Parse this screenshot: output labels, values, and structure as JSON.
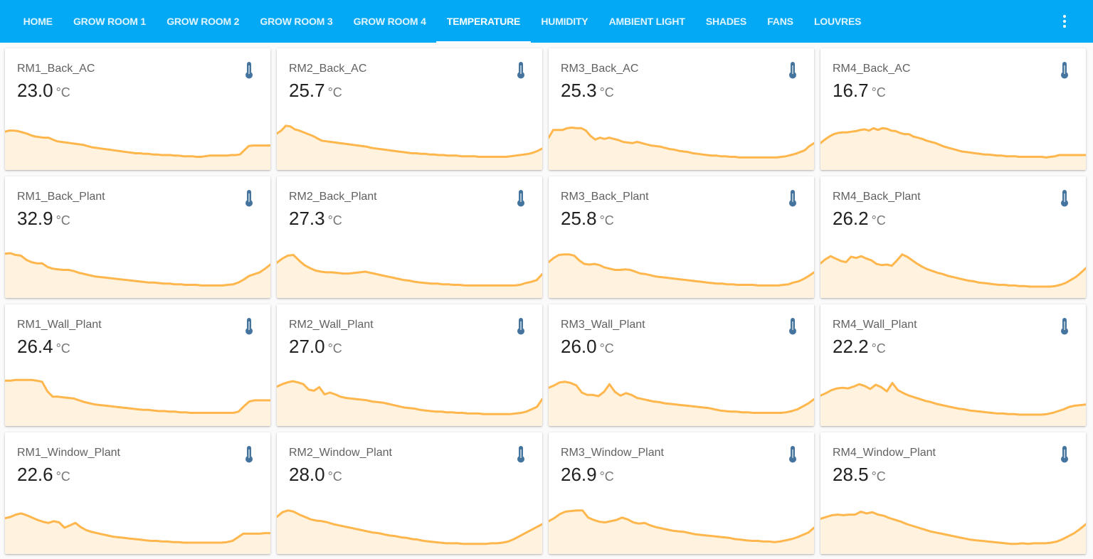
{
  "nav": {
    "tabs": [
      {
        "label": "HOME"
      },
      {
        "label": "GROW ROOM 1"
      },
      {
        "label": "GROW ROOM 2"
      },
      {
        "label": "GROW ROOM 3"
      },
      {
        "label": "GROW ROOM 4"
      },
      {
        "label": "TEMPERATURE"
      },
      {
        "label": "HUMIDITY"
      },
      {
        "label": "AMBIENT LIGHT"
      },
      {
        "label": "SHADES"
      },
      {
        "label": "FANS"
      },
      {
        "label": "LOUVRES"
      }
    ],
    "active_tab": "TEMPERATURE",
    "menu_icon": "dots-vertical-icon"
  },
  "colors": {
    "header": "#03a9f4",
    "line": "#ffb74d",
    "fill": "#fff3e0",
    "icon": "#44739e"
  },
  "unit": "°C",
  "sensor_icon": "thermometer-icon",
  "cards": [
    {
      "name": "RM1_Back_AC",
      "value": "23.0",
      "history": [
        64,
        66,
        66,
        65,
        63,
        61,
        58,
        56,
        55,
        54,
        54,
        51,
        48,
        47,
        46,
        45,
        44,
        43,
        42,
        40,
        38,
        37,
        36,
        35,
        34,
        33,
        32,
        31,
        30,
        29,
        28,
        28,
        27,
        27,
        26,
        26,
        25,
        25,
        25,
        24,
        24,
        23,
        23,
        23,
        22,
        22,
        23,
        24,
        24,
        24,
        24,
        24,
        25,
        25,
        26,
        33,
        40,
        41,
        41,
        41,
        41,
        41
      ]
    },
    {
      "name": "RM2_Back_AC",
      "value": "25.7",
      "history": [
        61,
        66,
        74,
        73,
        68,
        66,
        63,
        60,
        57,
        53,
        49,
        48,
        47,
        46,
        45,
        44,
        43,
        42,
        41,
        40,
        39,
        37,
        36,
        35,
        34,
        33,
        32,
        31,
        30,
        29,
        28,
        28,
        27,
        27,
        26,
        26,
        25,
        25,
        24,
        24,
        24,
        23,
        23,
        23,
        23,
        22,
        22,
        22,
        22,
        22,
        22,
        22,
        23,
        24,
        25,
        26,
        27,
        29,
        32,
        36
      ]
    },
    {
      "name": "RM3_Back_AC",
      "value": "25.3",
      "history": [
        54,
        67,
        67,
        67,
        70,
        71,
        70,
        70,
        66,
        57,
        51,
        54,
        52,
        54,
        52,
        50,
        47,
        46,
        45,
        47,
        45,
        43,
        41,
        40,
        39,
        37,
        35,
        34,
        32,
        31,
        30,
        28,
        27,
        26,
        25,
        24,
        24,
        23,
        23,
        22,
        22,
        21,
        21,
        21,
        21,
        21,
        21,
        21,
        21,
        21,
        22,
        23,
        25,
        27,
        30,
        33,
        40,
        45
      ]
    },
    {
      "name": "RM4_Back_AC",
      "value": "16.7",
      "history": [
        45,
        51,
        56,
        60,
        62,
        63,
        63,
        64,
        65,
        67,
        68,
        66,
        70,
        67,
        70,
        69,
        66,
        65,
        62,
        60,
        60,
        56,
        54,
        52,
        49,
        47,
        45,
        42,
        39,
        37,
        35,
        33,
        31,
        30,
        29,
        28,
        27,
        26,
        26,
        25,
        24,
        24,
        23,
        23,
        23,
        22,
        22,
        22,
        22,
        22,
        22,
        21,
        22,
        23,
        25,
        25,
        25,
        25,
        25,
        25,
        25
      ]
    },
    {
      "name": "RM1_Back_Plant",
      "value": "32.9",
      "history": [
        74,
        75,
        72,
        71,
        64,
        60,
        58,
        58,
        52,
        49,
        48,
        47,
        47,
        45,
        42,
        40,
        38,
        36,
        35,
        34,
        33,
        32,
        31,
        30,
        29,
        28,
        27,
        26,
        26,
        25,
        24,
        24,
        23,
        23,
        22,
        22,
        22,
        21,
        21,
        21,
        21,
        21,
        22,
        23,
        26,
        31,
        37,
        40,
        43,
        49,
        56
      ]
    },
    {
      "name": "RM2_Back_Plant",
      "value": "27.3",
      "history": [
        59,
        66,
        71,
        72,
        63,
        55,
        50,
        46,
        44,
        43,
        43,
        42,
        41,
        41,
        42,
        43,
        44,
        42,
        40,
        38,
        36,
        34,
        32,
        30,
        29,
        27,
        26,
        25,
        24,
        24,
        23,
        23,
        22,
        22,
        21,
        21,
        21,
        21,
        21,
        21,
        21,
        21,
        21,
        21,
        22,
        25,
        27,
        30,
        40
      ]
    },
    {
      "name": "RM3_Back_Plant",
      "value": "25.8",
      "history": [
        60,
        67,
        72,
        73,
        73,
        71,
        63,
        57,
        56,
        57,
        55,
        51,
        49,
        47,
        47,
        48,
        47,
        44,
        41,
        40,
        38,
        36,
        35,
        34,
        33,
        32,
        31,
        30,
        29,
        28,
        27,
        26,
        25,
        24,
        24,
        23,
        23,
        22,
        22,
        22,
        22,
        21,
        21,
        21,
        21,
        21,
        22,
        23,
        26,
        28,
        32,
        37,
        43
      ]
    },
    {
      "name": "RM4_Back_Plant",
      "value": "26.2",
      "history": [
        58,
        65,
        70,
        66,
        62,
        60,
        69,
        67,
        70,
        66,
        63,
        57,
        55,
        56,
        54,
        63,
        73,
        69,
        63,
        57,
        52,
        48,
        45,
        42,
        40,
        37,
        35,
        33,
        31,
        29,
        28,
        26,
        25,
        24,
        23,
        22,
        22,
        21,
        21,
        20,
        20,
        19,
        19,
        19,
        19,
        19,
        20,
        22,
        25,
        30,
        35,
        42,
        50
      ]
    },
    {
      "name": "RM1_Wall_Plant",
      "value": "26.4",
      "history": [
        76,
        76,
        77,
        77,
        77,
        77,
        76,
        74,
        58,
        49,
        49,
        48,
        47,
        46,
        43,
        40,
        38,
        36,
        35,
        34,
        33,
        32,
        31,
        30,
        29,
        28,
        27,
        27,
        26,
        25,
        25,
        24,
        24,
        23,
        23,
        22,
        22,
        22,
        22,
        22,
        22,
        22,
        22,
        22,
        24,
        33,
        41,
        43,
        43,
        43,
        43
      ]
    },
    {
      "name": "RM2_Wall_Plant",
      "value": "27.0",
      "history": [
        66,
        70,
        73,
        75,
        73,
        70,
        61,
        59,
        65,
        53,
        56,
        53,
        49,
        47,
        46,
        45,
        44,
        43,
        41,
        40,
        39,
        37,
        35,
        33,
        31,
        30,
        29,
        27,
        26,
        25,
        24,
        24,
        23,
        23,
        22,
        22,
        21,
        21,
        21,
        20,
        20,
        20,
        20,
        20,
        20,
        21,
        22,
        24,
        28,
        32,
        45
      ]
    },
    {
      "name": "RM3_Wall_Plant",
      "value": "26.0",
      "history": [
        64,
        68,
        73,
        74,
        72,
        68,
        56,
        52,
        52,
        50,
        57,
        70,
        57,
        51,
        55,
        52,
        47,
        45,
        43,
        41,
        40,
        38,
        37,
        36,
        35,
        34,
        33,
        32,
        31,
        30,
        28,
        26,
        25,
        24,
        24,
        23,
        23,
        22,
        22,
        22,
        22,
        22,
        22,
        23,
        25,
        28,
        33,
        38,
        45
      ]
    },
    {
      "name": "RM4_Wall_Plant",
      "value": "22.2",
      "history": [
        51,
        55,
        60,
        63,
        64,
        63,
        66,
        70,
        67,
        62,
        69,
        65,
        58,
        72,
        60,
        55,
        51,
        48,
        45,
        42,
        40,
        37,
        35,
        33,
        31,
        29,
        28,
        26,
        25,
        24,
        23,
        22,
        21,
        21,
        20,
        20,
        19,
        19,
        19,
        19,
        19,
        20,
        22,
        25,
        28,
        32,
        34,
        35,
        36
      ]
    },
    {
      "name": "RM1_Window_Plant",
      "value": "22.6",
      "history": [
        60,
        62,
        66,
        68,
        65,
        61,
        57,
        54,
        52,
        55,
        53,
        44,
        48,
        52,
        45,
        40,
        37,
        35,
        33,
        31,
        29,
        28,
        27,
        26,
        25,
        24,
        23,
        22,
        22,
        21,
        21,
        20,
        20,
        19,
        19,
        19,
        19,
        19,
        19,
        19,
        19,
        20,
        22,
        28,
        34,
        34,
        34,
        34,
        35,
        35
      ]
    },
    {
      "name": "RM2_Window_Plant",
      "value": "28.0",
      "history": [
        62,
        70,
        73,
        71,
        66,
        62,
        58,
        56,
        55,
        53,
        50,
        48,
        46,
        44,
        42,
        40,
        38,
        36,
        35,
        33,
        31,
        30,
        28,
        27,
        25,
        24,
        22,
        21,
        20,
        19,
        18,
        18,
        18,
        17,
        17,
        17,
        17,
        17,
        18,
        18,
        19,
        21,
        25,
        30,
        35,
        40,
        45,
        50
      ]
    },
    {
      "name": "RM3_Window_Plant",
      "value": "26.9",
      "history": [
        55,
        60,
        67,
        71,
        72,
        73,
        73,
        61,
        57,
        54,
        53,
        55,
        57,
        61,
        58,
        53,
        51,
        52,
        48,
        45,
        43,
        41,
        39,
        38,
        37,
        35,
        33,
        32,
        31,
        30,
        29,
        28,
        27,
        25,
        24,
        23,
        22,
        22,
        21,
        21,
        20,
        21,
        23,
        25,
        28,
        32,
        36,
        44
      ]
    },
    {
      "name": "RM4_Window_Plant",
      "value": "28.5",
      "history": [
        59,
        62,
        65,
        66,
        65,
        66,
        66,
        71,
        68,
        70,
        66,
        64,
        60,
        57,
        54,
        50,
        47,
        44,
        41,
        38,
        36,
        34,
        32,
        30,
        28,
        26,
        24,
        23,
        22,
        21,
        20,
        19,
        18,
        17,
        17,
        18,
        17,
        18,
        18,
        18,
        19,
        21,
        25,
        30,
        35,
        42,
        50
      ]
    }
  ]
}
